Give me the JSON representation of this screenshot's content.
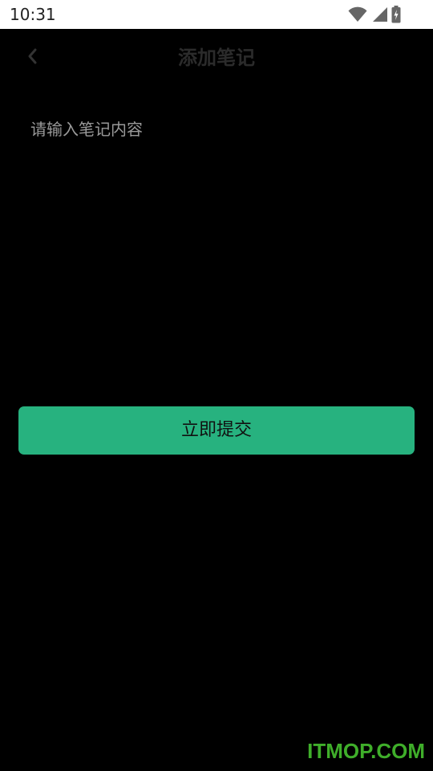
{
  "status_bar": {
    "time": "10:31",
    "icons": [
      "wifi-icon",
      "signal-icon",
      "battery-charging-icon"
    ]
  },
  "header": {
    "back_icon": "chevron-left-icon",
    "title": "添加笔记"
  },
  "note": {
    "value": "",
    "placeholder": "请输入笔记内容"
  },
  "submit": {
    "label": "立即提交"
  },
  "watermark": {
    "text": "ITMOP.COM"
  },
  "colors": {
    "background": "#000000",
    "status_bar": "#ffffff",
    "accent": "#27b27f",
    "title": "#2b2b2b",
    "placeholder": "#9a9a9a",
    "watermark": "#3fae2a"
  }
}
